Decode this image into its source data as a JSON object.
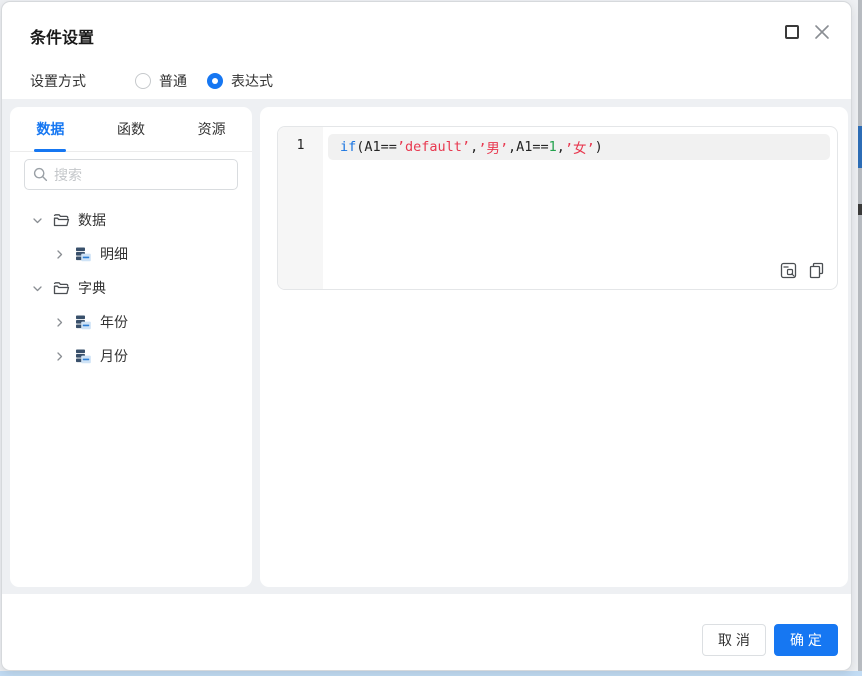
{
  "dialog": {
    "title": "条件设置"
  },
  "settings": {
    "label": "设置方式",
    "options": [
      {
        "label": "普通",
        "selected": false
      },
      {
        "label": "表达式",
        "selected": true
      }
    ]
  },
  "sidebar": {
    "tabs": [
      {
        "label": "数据",
        "active": true
      },
      {
        "label": "函数",
        "active": false
      },
      {
        "label": "资源",
        "active": false
      }
    ],
    "search": {
      "placeholder": "搜索",
      "value": ""
    },
    "tree": [
      {
        "label": "数据",
        "level": 1,
        "type": "folder",
        "expanded": true
      },
      {
        "label": "明细",
        "level": 2,
        "type": "table",
        "expanded": false
      },
      {
        "label": "字典",
        "level": 1,
        "type": "folder",
        "expanded": true
      },
      {
        "label": "年份",
        "level": 2,
        "type": "table",
        "expanded": false
      },
      {
        "label": "月份",
        "level": 2,
        "type": "table",
        "expanded": false
      }
    ]
  },
  "editor": {
    "line_number": "1",
    "code_plain": "if(A1==’default’,’男’,A1==1,’女’)",
    "tokens": [
      {
        "type": "keyword",
        "text": "if"
      },
      {
        "type": "plain",
        "text": "(A1=="
      },
      {
        "type": "string",
        "text": "’default’"
      },
      {
        "type": "plain",
        "text": ","
      },
      {
        "type": "string",
        "text": "’男’"
      },
      {
        "type": "plain",
        "text": ","
      },
      {
        "type": "plain",
        "text": "A1=="
      },
      {
        "type": "number",
        "text": "1"
      },
      {
        "type": "plain",
        "text": ","
      },
      {
        "type": "string",
        "text": "’女’"
      },
      {
        "type": "plain",
        "text": ")"
      }
    ],
    "token_colors": {
      "keyword": "#1673e1",
      "string": "#e8384f",
      "number": "#22a24c",
      "plain": "#262626"
    }
  },
  "footer": {
    "cancel": "取 消",
    "confirm": "确 定"
  },
  "colors": {
    "accent": "#1677f2",
    "body_gray": "#eef0f3",
    "line_highlight": "#f1f1f1"
  }
}
